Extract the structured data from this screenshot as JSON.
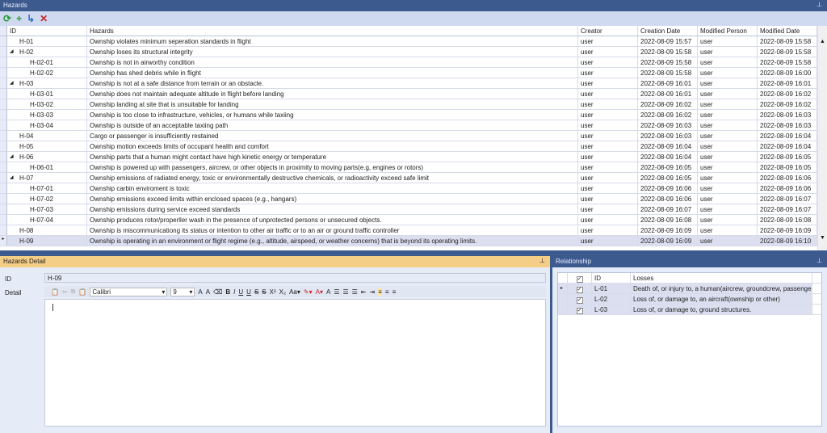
{
  "hazards_panel": {
    "title": "Hazards",
    "columns": [
      "ID",
      "Hazards",
      "Creator",
      "Creation Date",
      "Modified Person",
      "Modified Date"
    ],
    "rows": [
      {
        "id": "H-01",
        "level": 0,
        "expanded": null,
        "hazard": "Ownship violates minimum seperation standards in flight",
        "creator": "user",
        "created": "2022-08-09 15:57",
        "modified_by": "user",
        "modified": "2022-08-09 15:58"
      },
      {
        "id": "H-02",
        "level": 0,
        "expanded": true,
        "hazard": "Ownship loses its structural integrity",
        "creator": "user",
        "created": "2022-08-09 15:58",
        "modified_by": "user",
        "modified": "2022-08-09 15:58"
      },
      {
        "id": "H-02-01",
        "level": 1,
        "expanded": null,
        "hazard": "Ownship is not in airworthy condition",
        "creator": "user",
        "created": "2022-08-09 15:58",
        "modified_by": "user",
        "modified": "2022-08-09 15:58"
      },
      {
        "id": "H-02-02",
        "level": 1,
        "expanded": null,
        "hazard": "Ownship has shed debris while in flight",
        "creator": "user",
        "created": "2022-08-09 15:58",
        "modified_by": "user",
        "modified": "2022-08-09 16:00"
      },
      {
        "id": "H-03",
        "level": 0,
        "expanded": true,
        "hazard": "Ownship is not at a safe distance from terrain or an obstacle.",
        "creator": "user",
        "created": "2022-08-09 16:01",
        "modified_by": "user",
        "modified": "2022-08-09 16:01"
      },
      {
        "id": "H-03-01",
        "level": 1,
        "expanded": null,
        "hazard": "Ownship does not maintain adequate altitude in flight before landing",
        "creator": "user",
        "created": "2022-08-09 16:01",
        "modified_by": "user",
        "modified": "2022-08-09 16:02"
      },
      {
        "id": "H-03-02",
        "level": 1,
        "expanded": null,
        "hazard": "Ownship landing at site that is unsuitable for landing",
        "creator": "user",
        "created": "2022-08-09 16:02",
        "modified_by": "user",
        "modified": "2022-08-09 16:02"
      },
      {
        "id": "H-03-03",
        "level": 1,
        "expanded": null,
        "hazard": "Ownship is too close to infrastructure, vehicles, or humans while taxiing",
        "creator": "user",
        "created": "2022-08-09 16:02",
        "modified_by": "user",
        "modified": "2022-08-09 16:03"
      },
      {
        "id": "H-03-04",
        "level": 1,
        "expanded": null,
        "hazard": "Ownship is outside of an acceptable taxiing path",
        "creator": "user",
        "created": "2022-08-09 16:03",
        "modified_by": "user",
        "modified": "2022-08-09 16:03"
      },
      {
        "id": "H-04",
        "level": 0,
        "expanded": null,
        "hazard": "Cargo or passenger is insufficiently restained",
        "creator": "user",
        "created": "2022-08-09 16:03",
        "modified_by": "user",
        "modified": "2022-08-09 16:04"
      },
      {
        "id": "H-05",
        "level": 0,
        "expanded": null,
        "hazard": "Ownship motion exceeds limits of occupant health and comfort",
        "creator": "user",
        "created": "2022-08-09 16:04",
        "modified_by": "user",
        "modified": "2022-08-09 16:04"
      },
      {
        "id": "H-06",
        "level": 0,
        "expanded": true,
        "hazard": "Ownship parts that a human might contact have high kinetic energy or temperature",
        "creator": "user",
        "created": "2022-08-09 16:04",
        "modified_by": "user",
        "modified": "2022-08-09 16:05"
      },
      {
        "id": "H-06-01",
        "level": 1,
        "expanded": null,
        "hazard": "Ownship is powered up with passengers, aircrew, or other objects in proximity to moving parts(e.g, engines or rotors)",
        "creator": "user",
        "created": "2022-08-09 16:05",
        "modified_by": "user",
        "modified": "2022-08-09 16:05"
      },
      {
        "id": "H-07",
        "level": 0,
        "expanded": true,
        "hazard": "Ownship emissions of radiated energy, toxic or environmentally destructive chemicals, or radioactivity exceed safe limit",
        "creator": "user",
        "created": "2022-08-09 16:05",
        "modified_by": "user",
        "modified": "2022-08-09 16:06"
      },
      {
        "id": "H-07-01",
        "level": 1,
        "expanded": null,
        "hazard": "Ownship carbin enviroment is toxic",
        "creator": "user",
        "created": "2022-08-09 16:06",
        "modified_by": "user",
        "modified": "2022-08-09 16:06"
      },
      {
        "id": "H-07-02",
        "level": 1,
        "expanded": null,
        "hazard": "Ownship emissions exceed limits within enclosed spaces (e.g., hangars)",
        "creator": "user",
        "created": "2022-08-09 16:06",
        "modified_by": "user",
        "modified": "2022-08-09 16:07"
      },
      {
        "id": "H-07-03",
        "level": 1,
        "expanded": null,
        "hazard": "Ownship emissions during service exceed standards",
        "creator": "user",
        "created": "2022-08-09 16:07",
        "modified_by": "user",
        "modified": "2022-08-09 16:07"
      },
      {
        "id": "H-07-04",
        "level": 1,
        "expanded": null,
        "hazard": "Ownship produces rotor/properller wash in the presence of unprotected persons or unsecured objects.",
        "creator": "user",
        "created": "2022-08-09 16:08",
        "modified_by": "user",
        "modified": "2022-08-09 16:08"
      },
      {
        "id": "H-08",
        "level": 0,
        "expanded": null,
        "hazard": "Ownship is miscommunicationg its status or intention to other air traffic or to an air or ground traffic controller",
        "creator": "user",
        "created": "2022-08-09 16:09",
        "modified_by": "user",
        "modified": "2022-08-09 16:09"
      },
      {
        "id": "H-09",
        "level": 0,
        "expanded": null,
        "selected": true,
        "hazard": "Ownship is operating in an environment or flight regime (e.g., altitude, airspeed, or weather concerns) that is beyond its operating limits.",
        "creator": "user",
        "created": "2022-08-09 16:09",
        "modified_by": "user",
        "modified": "2022-08-09 16:10"
      }
    ]
  },
  "detail_panel": {
    "title": "Hazards Detail",
    "id_label": "ID",
    "id_value": "H-09",
    "detail_label": "Detail",
    "font": "Calibri",
    "font_size": "9",
    "detail_text": ""
  },
  "relationship_panel": {
    "title": "Relationship",
    "columns": [
      "ID",
      "Losses"
    ],
    "rows": [
      {
        "id": "L-01",
        "checked": true,
        "loss": "Death of, or injury to, a human(aircrew, groundcrew, passenger, o..."
      },
      {
        "id": "L-02",
        "checked": true,
        "loss": "Loss of, or damage to, an aircraft(ownship or other)"
      },
      {
        "id": "L-03",
        "checked": true,
        "loss": "Loss of, or damage to, ground structures."
      }
    ]
  },
  "colors": {
    "title_blue": "#3d5a8f",
    "detail_header": "#f4cd86",
    "selected_row": "#dcdff0"
  }
}
